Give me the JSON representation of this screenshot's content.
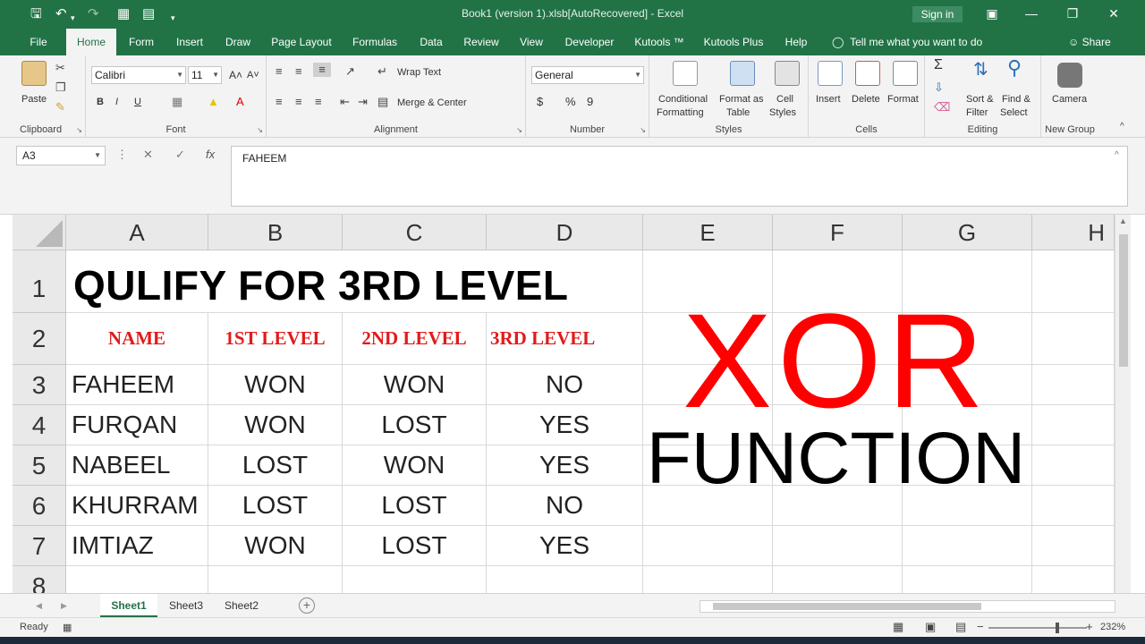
{
  "window": {
    "title": "Book1 (version 1).xlsb[AutoRecovered] - Excel",
    "sign_in": "Sign in",
    "share": "Share",
    "tell_me": "Tell me what you want to do"
  },
  "tabs": [
    "File",
    "Home",
    "Form",
    "Insert",
    "Draw",
    "Page Layout",
    "Formulas",
    "Data",
    "Review",
    "View",
    "Developer",
    "Kutools ™",
    "Kutools Plus",
    "Help"
  ],
  "active_tab": "Home",
  "ribbon": {
    "clipboard": {
      "label": "Clipboard",
      "paste": "Paste"
    },
    "font": {
      "label": "Font",
      "name": "Calibri",
      "size": "11",
      "bold": "B",
      "italic": "I",
      "underline": "U",
      "grow": "A˄",
      "shrink": "A˅"
    },
    "alignment": {
      "label": "Alignment",
      "wrap": "Wrap Text",
      "merge": "Merge & Center"
    },
    "number": {
      "label": "Number",
      "format": "General",
      "currency": "$",
      "percent": "%",
      "comma": "9"
    },
    "styles": {
      "label": "Styles",
      "conditional_1": "Conditional",
      "conditional_2": "Formatting",
      "format_table_1": "Format as",
      "format_table_2": "Table",
      "cell_styles_1": "Cell",
      "cell_styles_2": "Styles"
    },
    "cells": {
      "label": "Cells",
      "insert": "Insert",
      "delete": "Delete",
      "format": "Format"
    },
    "editing": {
      "label": "Editing",
      "sort_1": "Sort &",
      "sort_2": "Filter",
      "find_1": "Find &",
      "find_2": "Select",
      "sigma": "Σ"
    },
    "new_group": {
      "label": "New Group",
      "camera": "Camera"
    }
  },
  "formula_bar": {
    "name_box": "A3",
    "content": "FAHEEM",
    "fx": "fx"
  },
  "columns": [
    "A",
    "B",
    "C",
    "D",
    "E",
    "F",
    "G",
    "H"
  ],
  "rows": [
    "1",
    "2",
    "3",
    "4",
    "5",
    "6",
    "7",
    "8"
  ],
  "sheet": {
    "title": "QULIFY FOR 3RD LEVEL",
    "headers": [
      "NAME",
      "1ST LEVEL",
      "2ND LEVEL",
      "3RD LEVEL"
    ],
    "data": [
      [
        "FAHEEM",
        "WON",
        "WON",
        "NO"
      ],
      [
        "FURQAN",
        "WON",
        "LOST",
        "YES"
      ],
      [
        "NABEEL",
        "LOST",
        "WON",
        "YES"
      ],
      [
        "KHURRAM",
        "LOST",
        "LOST",
        "NO"
      ],
      [
        "IMTIAZ",
        "WON",
        "LOST",
        "YES"
      ]
    ],
    "overlay_big": "XOR",
    "overlay_sub": "FUNCTION"
  },
  "sheet_tabs": [
    "Sheet1",
    "Sheet3",
    "Sheet2"
  ],
  "active_sheet": "Sheet1",
  "status": {
    "ready": "Ready",
    "zoom": "232%"
  },
  "colors": {
    "excel_green": "#217346",
    "header_red": "#e11b1b",
    "xor_red": "#ff0000"
  }
}
